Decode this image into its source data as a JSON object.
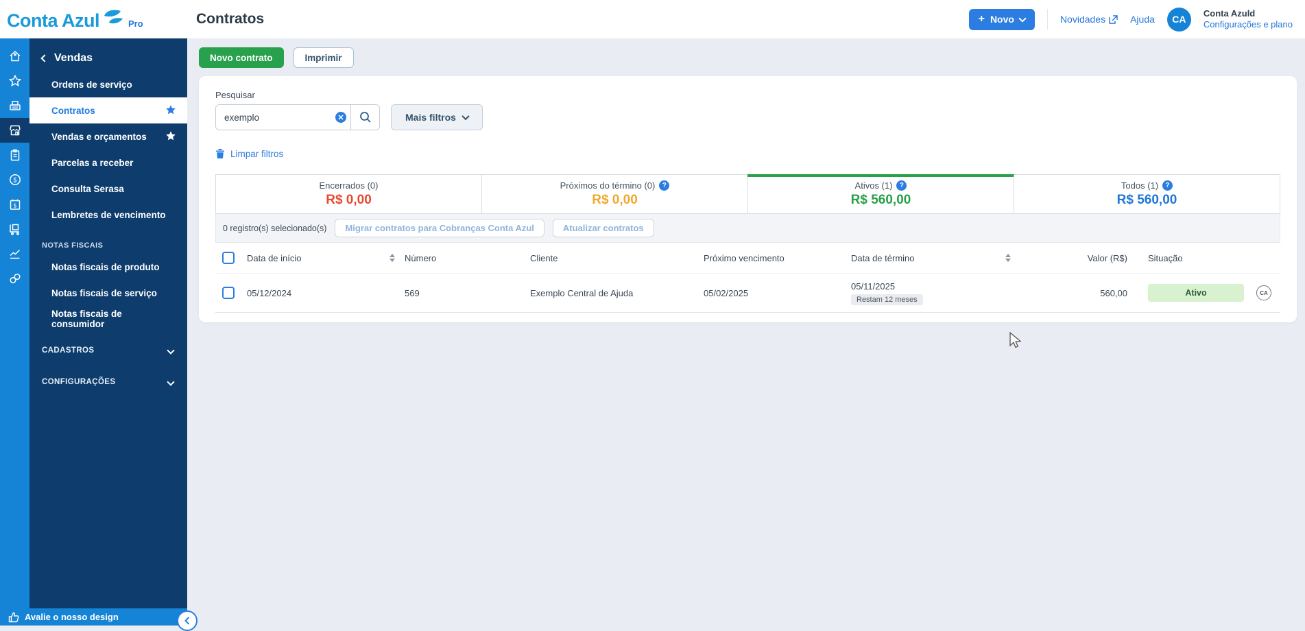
{
  "colors": {
    "brand_blue": "#1a9ad8",
    "rail_blue": "#1583d6",
    "navy": "#0e3d6d",
    "accent_blue": "#2b7de1",
    "green": "#27a14b",
    "red": "#e8492e",
    "orange": "#f0a92e",
    "link_blue": "#2276d9"
  },
  "topbar": {
    "logo_text": "Conta Azul",
    "logo_badge": "Pro",
    "page_title": "Contratos",
    "novo_label": "Novo",
    "novidades_label": "Novidades",
    "ajuda_label": "Ajuda",
    "account_initials": "CA",
    "account_name": "Conta Azuld",
    "account_settings": "Configurações e plano"
  },
  "sidebar": {
    "menu_title": "Vendas",
    "items": [
      {
        "label": "Ordens de serviço",
        "active": false,
        "starred": false
      },
      {
        "label": "Contratos",
        "active": true,
        "starred": true
      },
      {
        "label": "Vendas e orçamentos",
        "active": false,
        "starred": true
      },
      {
        "label": "Parcelas a receber",
        "active": false,
        "starred": false
      },
      {
        "label": "Consulta Serasa",
        "active": false,
        "starred": false
      },
      {
        "label": "Lembretes de vencimento",
        "active": false,
        "starred": false
      }
    ],
    "section_label": "NOTAS FISCAIS",
    "section_items": [
      {
        "label": "Notas fiscais de produto"
      },
      {
        "label": "Notas fiscais de serviço"
      },
      {
        "label": "Notas fiscais de consumidor"
      }
    ],
    "collapsed_sections": [
      {
        "label": "CADASTROS"
      },
      {
        "label": "CONFIGURAÇÕES"
      }
    ],
    "rail_icons": [
      "home",
      "favorites",
      "cash-register",
      "store",
      "notes",
      "money",
      "billing-calendar",
      "purchases",
      "reports",
      "integrations"
    ],
    "footer_label": "Avalie o nosso design"
  },
  "toolbar": {
    "new_contract_label": "Novo contrato",
    "print_label": "Imprimir"
  },
  "filters": {
    "search_label": "Pesquisar",
    "search_value": "exemplo",
    "more_filters_label": "Mais filtros",
    "clear_filters_label": "Limpar filtros"
  },
  "summary_tabs": [
    {
      "label": "Encerrados (0)",
      "value": "R$ 0,00",
      "color": "#e8492e",
      "help": false,
      "active": false
    },
    {
      "label": "Próximos do término (0)",
      "value": "R$ 0,00",
      "color": "#f0a92e",
      "help": true,
      "active": false
    },
    {
      "label": "Ativos (1)",
      "value": "R$ 560,00",
      "color": "#27a14b",
      "help": true,
      "active": true
    },
    {
      "label": "Todos (1)",
      "value": "R$ 560,00",
      "color": "#2276d9",
      "help": true,
      "active": false
    }
  ],
  "bulk_bar": {
    "selected_text": "0 registro(s) selecionado(s)",
    "migrate_label": "Migrar contratos para Cobranças Conta Azul",
    "update_label": "Atualizar contratos"
  },
  "table": {
    "columns": {
      "start_date": "Data de início",
      "number": "Número",
      "client": "Cliente",
      "next_due": "Próximo vencimento",
      "end_date": "Data de término",
      "value": "Valor (R$)",
      "status": "Situação"
    },
    "rows": [
      {
        "start_date": "05/12/2024",
        "number": "569",
        "client": "Exemplo Central de Ajuda",
        "next_due": "05/02/2025",
        "end_date": "05/11/2025",
        "end_date_note": "Restam 12 meses",
        "value": "560,00",
        "status": "Ativo",
        "row_icon": "conta-azul-mini"
      }
    ]
  }
}
